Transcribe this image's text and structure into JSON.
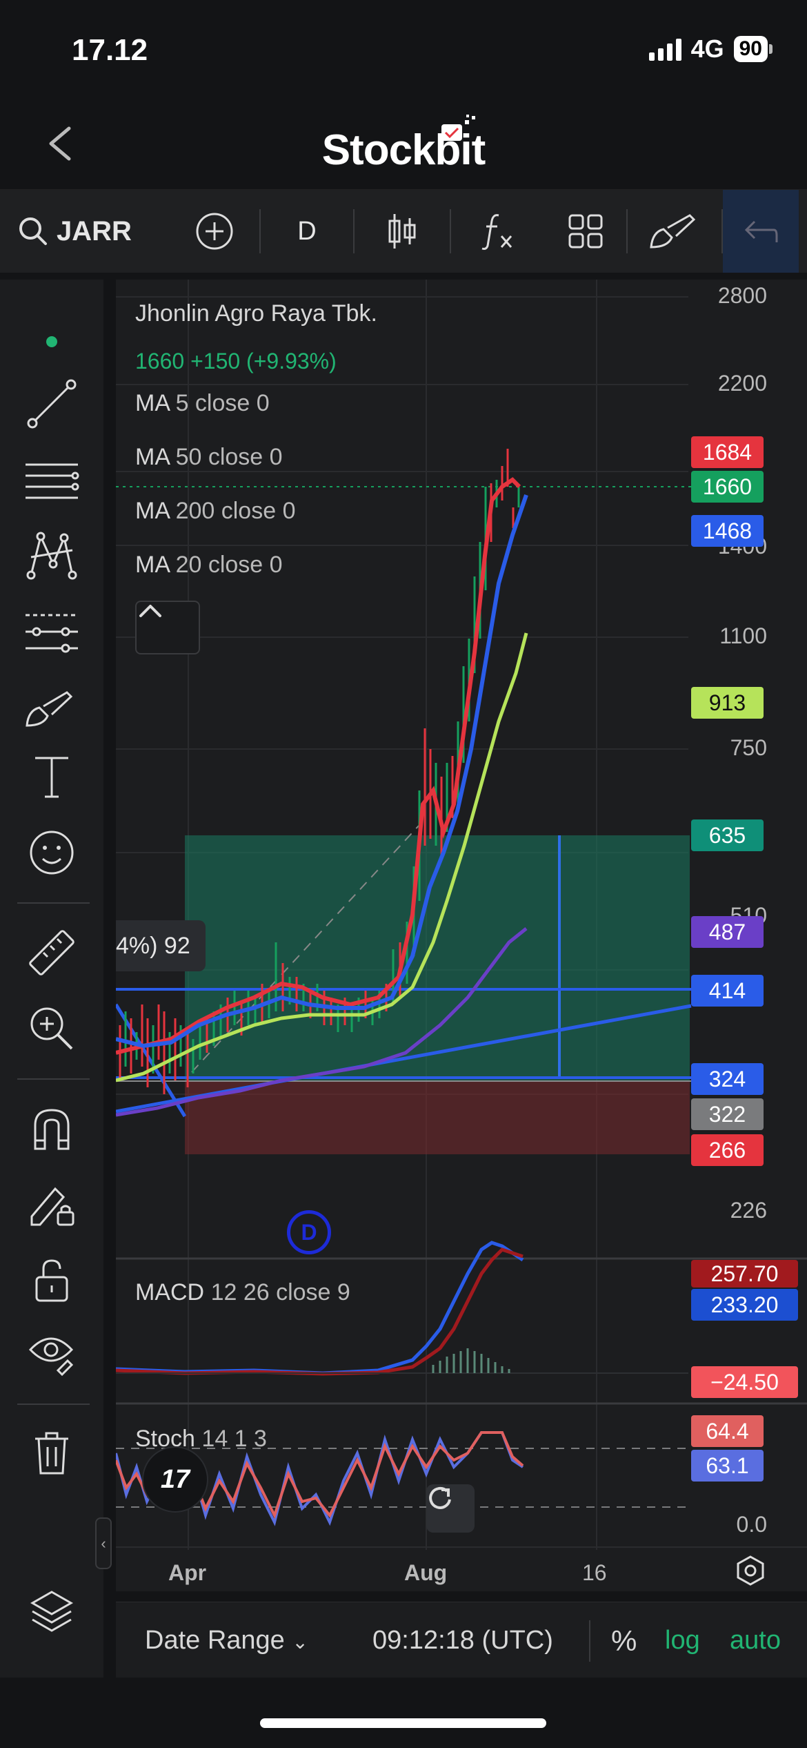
{
  "status_bar": {
    "time": "17.12",
    "network": "4G",
    "battery": "90"
  },
  "header": {
    "brand": "Stockbit"
  },
  "toolbar": {
    "symbol": "JARR",
    "interval": "D"
  },
  "chart": {
    "company": "Jhonlin Agro Raya Tbk.",
    "price_line": "1660  +150 (+9.93%)",
    "indicators": [
      {
        "name": "MA",
        "params": "5 close 0"
      },
      {
        "name": "MA",
        "params": "50 close 0"
      },
      {
        "name": "MA",
        "params": "200 close 0"
      },
      {
        "name": "MA",
        "params": "20 close 0"
      }
    ],
    "macd": {
      "name": "MACD",
      "params": "12 26 close 9"
    },
    "stoch": {
      "name": "Stoch",
      "params": "14 1 3"
    },
    "measure_label": "4%) 92",
    "marker": "D",
    "tv_logo": "17"
  },
  "y_ticks": [
    "2800",
    "2200",
    "1400",
    "1100",
    "750",
    "510",
    "226",
    "0.0"
  ],
  "badges": [
    {
      "label": "1684",
      "color": "#e5343e"
    },
    {
      "label": "1660",
      "color": "#15a05e"
    },
    {
      "label": "1468",
      "color": "#2a5ce8"
    },
    {
      "label": "913",
      "color": "#b6e35a"
    },
    {
      "label": "635",
      "color": "#0f8f78"
    },
    {
      "label": "487",
      "color": "#6a3fc7"
    },
    {
      "label": "414",
      "color": "#2a5ce8"
    },
    {
      "label": "324",
      "color": "#2a5ce8"
    },
    {
      "label": "322",
      "color": "#7a7b7d"
    },
    {
      "label": "266",
      "color": "#e5343e"
    }
  ],
  "macd_badges": [
    {
      "label": "257.70",
      "color": "#a11a1e"
    },
    {
      "label": "233.20",
      "color": "#1c4fd1"
    },
    {
      "label": "−24.50",
      "color": "#f2545b"
    }
  ],
  "stoch_badges": [
    {
      "label": "64.4",
      "color": "#e0605f"
    },
    {
      "label": "63.1",
      "color": "#5a6ee0"
    }
  ],
  "x_ticks": [
    "Apr",
    "Aug",
    "16"
  ],
  "bottom_bar": {
    "date_range": "Date Range",
    "time": "09:12:18 (UTC)",
    "percent": "%",
    "log": "log",
    "auto": "auto"
  },
  "colors": {
    "up": "#15a05e",
    "down": "#e5343e",
    "ma5": "#e5343e",
    "ma20": "#2a5ce8",
    "ma50": "#b6e35a",
    "ma200": "#6a3fc7"
  }
}
